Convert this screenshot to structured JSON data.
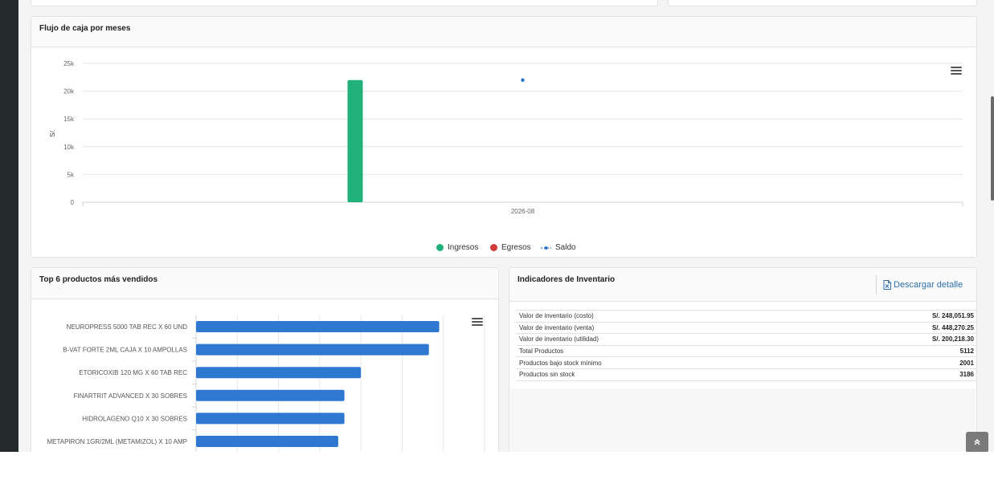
{
  "cashflow": {
    "title": "Flujo de caja por meses",
    "chart_data": {
      "type": "bar",
      "categories": [
        "2026-08"
      ],
      "series": [
        {
          "name": "Ingresos",
          "type": "bar",
          "color": "#20b27a",
          "values": [
            22000
          ]
        },
        {
          "name": "Egresos",
          "type": "bar",
          "color": "#d13b3b",
          "values": [
            0
          ]
        },
        {
          "name": "Saldo",
          "type": "line",
          "color": "#2c74c9",
          "values": [
            22000
          ]
        }
      ],
      "ylabel": "S/.",
      "ylim": [
        0,
        25000
      ],
      "yticks": [
        "0",
        "5k",
        "10k",
        "15k",
        "20k",
        "25k"
      ],
      "ytick_values": [
        0,
        5000,
        10000,
        15000,
        20000,
        25000
      ],
      "grid": true,
      "legend": "bottom"
    }
  },
  "top_products": {
    "title": "Top 6 productos más vendidos",
    "chart_data": {
      "type": "bar",
      "orientation": "horizontal",
      "color": "#2f78d1",
      "categories": [
        "NEUROPRESS 5000 TAB REC X 60 UND",
        "B-VAT FORTE 2ML CAJA X 10 AMPOLLAS",
        "ETORICOXIB 120 MG X 60 TAB REC",
        "FINARTRIT ADVANCED X 30 SOBRES",
        "HIDROLAGENO Q10 X 30 SOBRES",
        "METAPIRON 1GR/2ML (METAMIZOL) X 10 AMP"
      ],
      "values": [
        59,
        56.5,
        40,
        36,
        36,
        34.5
      ],
      "xlim": [
        0,
        70
      ],
      "grid": true
    }
  },
  "inventory": {
    "title": "Indicadores de Inventario",
    "download_label": "Descargar detalle",
    "rows": [
      {
        "label": "Valor de inventario (costo)",
        "value": "S/. 248,051.95"
      },
      {
        "label": "Valor de inventario (venta)",
        "value": "S/. 448,270.25"
      },
      {
        "label": "Valor de inventario (utilidad)",
        "value": "S/. 200,218.30"
      },
      {
        "label": "Total Productos",
        "value": "5112"
      },
      {
        "label": "Productos bajo stock mínimo",
        "value": "2001"
      },
      {
        "label": "Productos sin stock",
        "value": "3186"
      }
    ]
  },
  "icons": {
    "chart_menu": "hamburger-menu-icon",
    "download": "file-excel-icon",
    "scroll_top": "double-chevron-up-icon"
  }
}
